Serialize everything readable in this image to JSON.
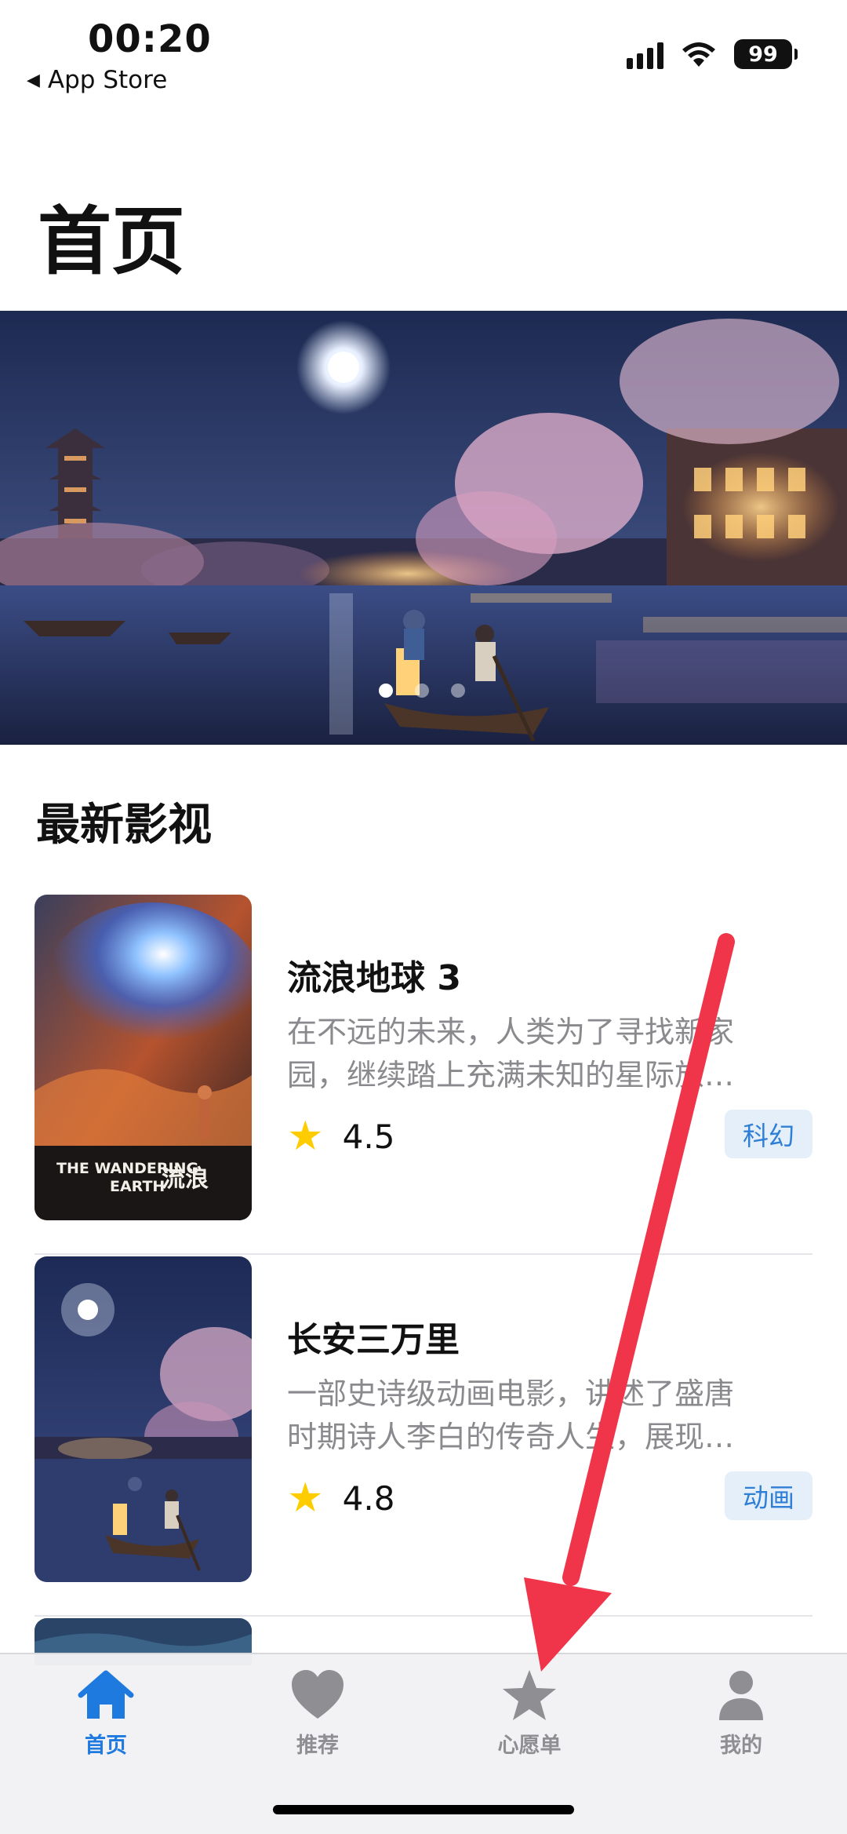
{
  "status_bar": {
    "time": "00:20",
    "back_app": "App Store",
    "battery": "99"
  },
  "header": {
    "title": "首页"
  },
  "banner": {
    "slide_count": 3,
    "active_slide": 1
  },
  "section": {
    "title": "最新影视"
  },
  "movies": [
    {
      "title": "流浪地球 3",
      "desc_line1": "在不远的未来，人类为了寻找新家",
      "desc_line2": "园，继续踏上充满未知的星际旅…",
      "rating": "4.5",
      "tag": "科幻",
      "poster_text_en": "THE WANDERING EARTH",
      "poster_text_cn": "流浪地球"
    },
    {
      "title": "长安三万里",
      "desc_line1": "一部史诗级动画电影，讲述了盛唐",
      "desc_line2": "时期诗人李白的传奇人生，展现…",
      "rating": "4.8",
      "tag": "动画"
    }
  ],
  "tab_bar": {
    "items": [
      {
        "label": "首页",
        "icon": "house-icon",
        "active": true
      },
      {
        "label": "推荐",
        "icon": "heart-icon",
        "active": false
      },
      {
        "label": "心愿单",
        "icon": "star-icon",
        "active": false
      },
      {
        "label": "我的",
        "icon": "person-icon",
        "active": false
      }
    ]
  },
  "colors": {
    "accent": "#1f7ae0",
    "tag_bg": "#e4eff9",
    "star": "#ffcc00",
    "annotation_arrow": "#f0344a"
  }
}
